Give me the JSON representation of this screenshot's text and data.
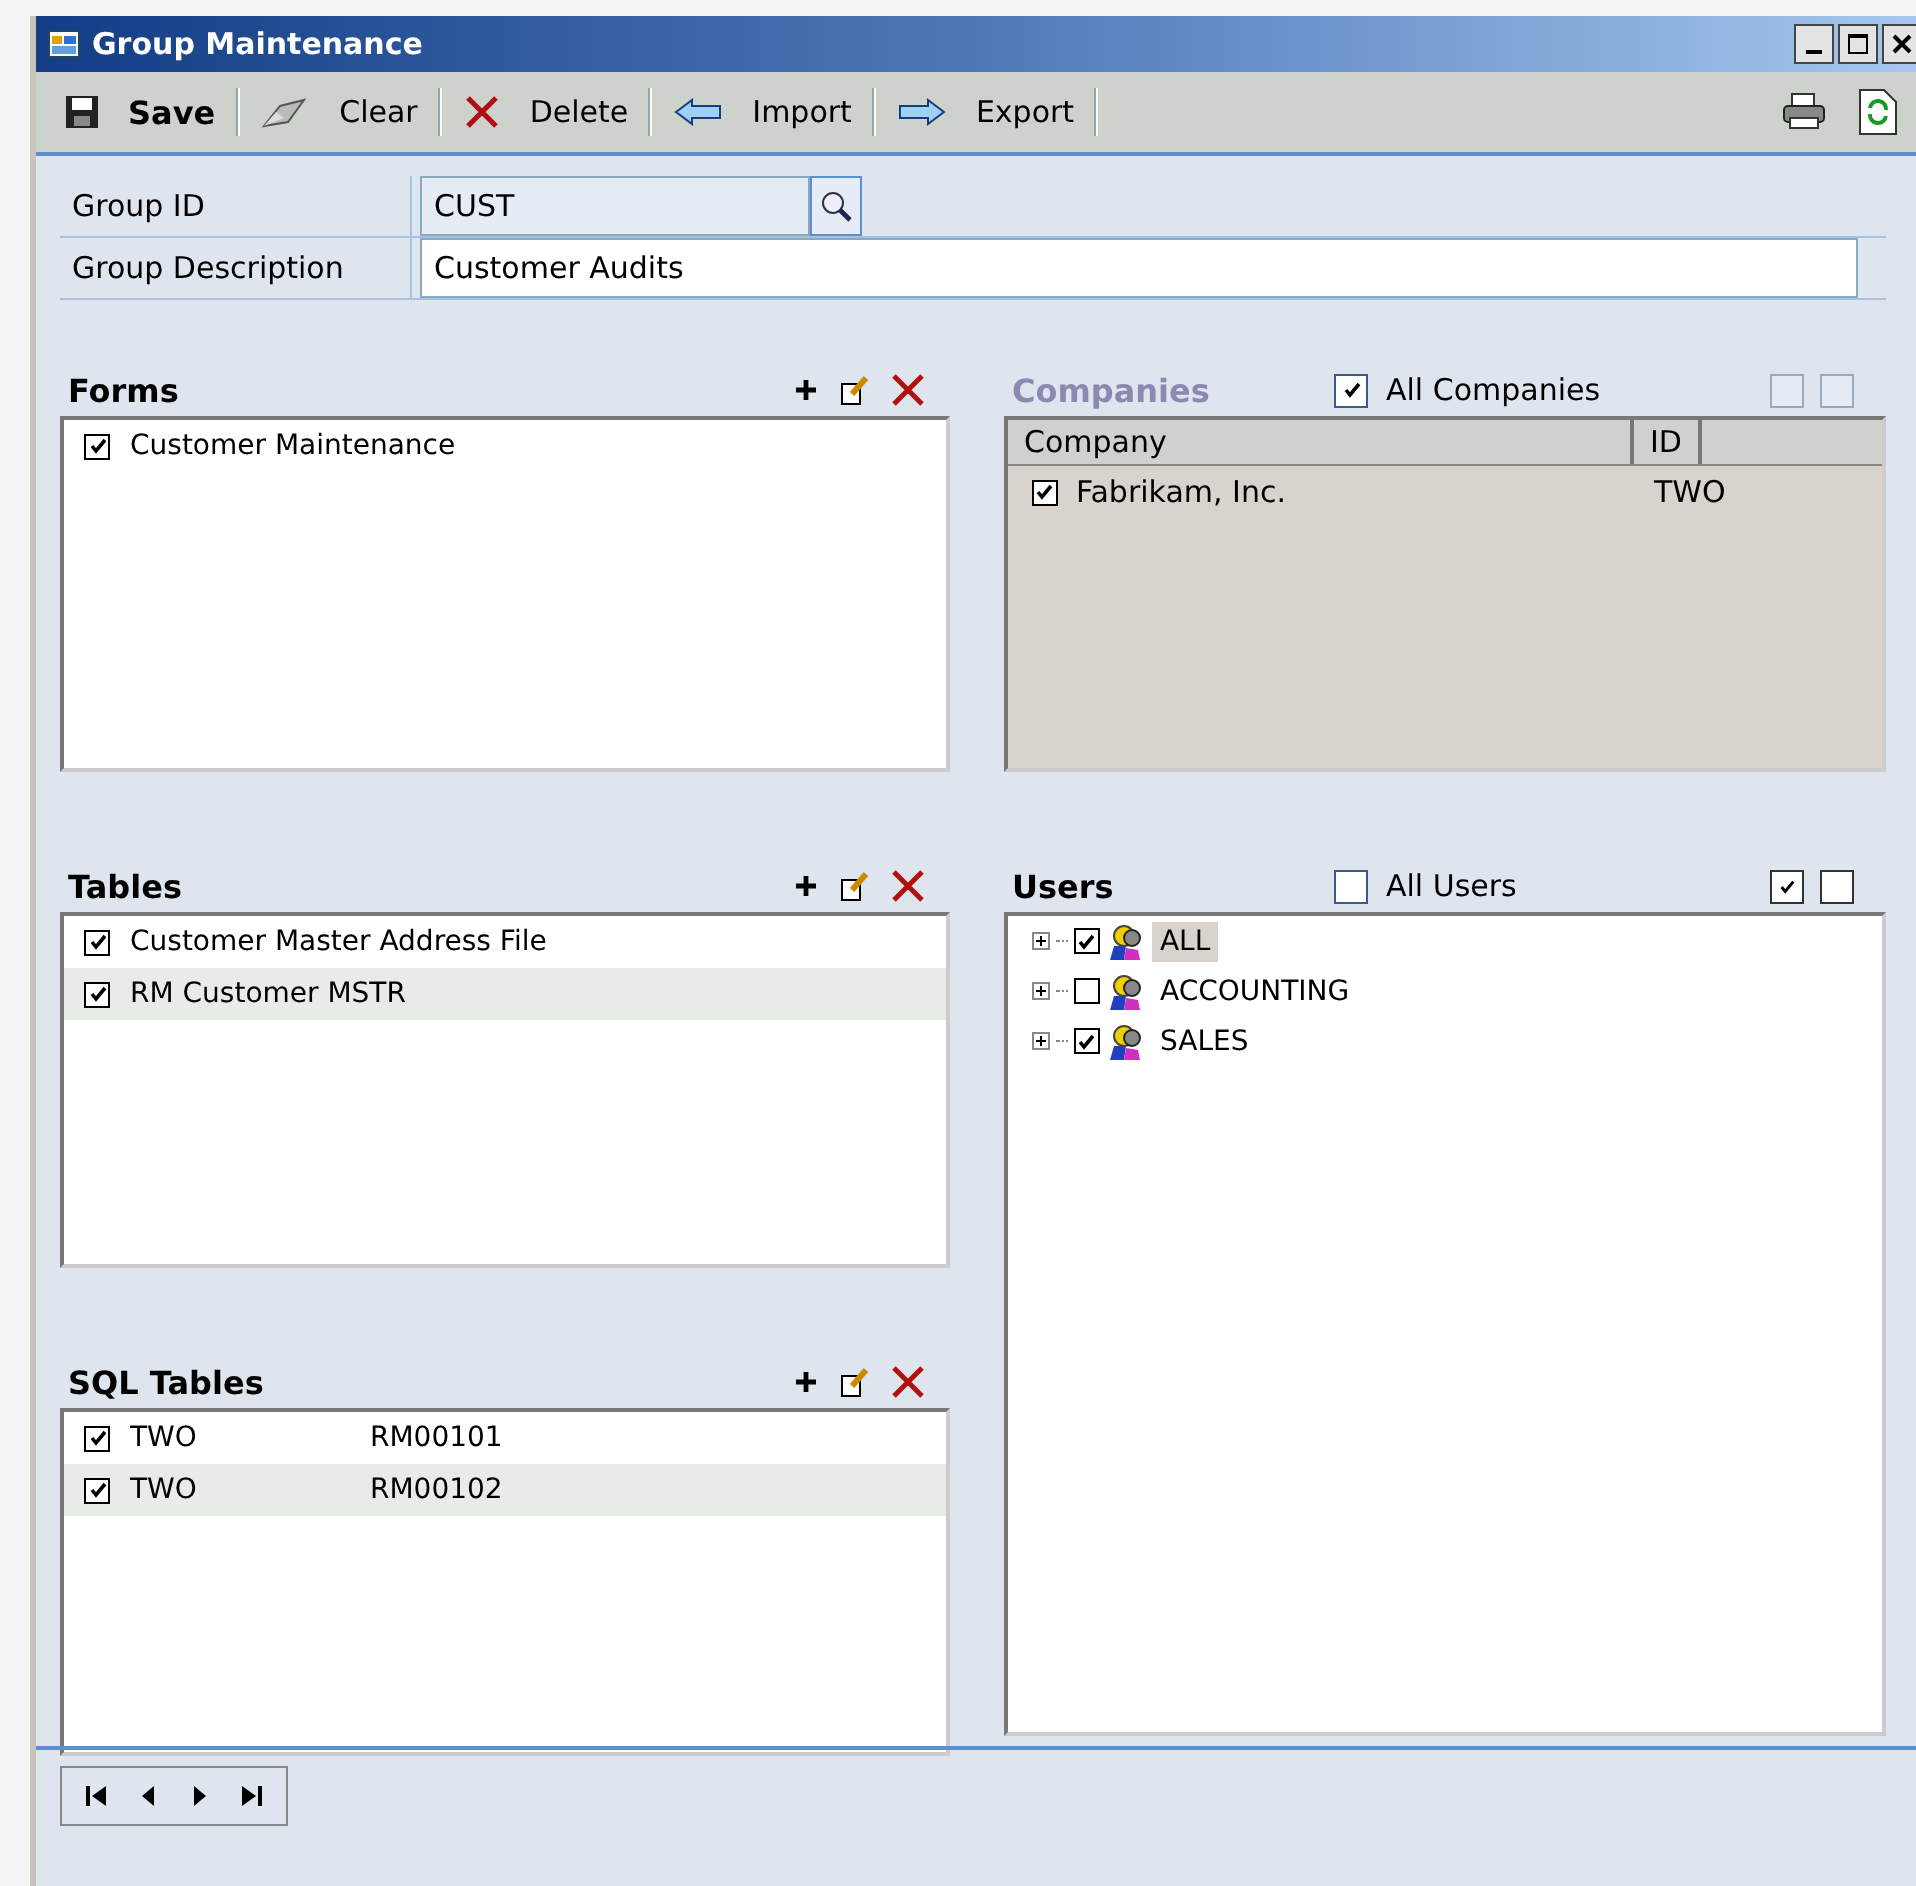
{
  "window": {
    "title": "Group Maintenance"
  },
  "toolbar": [
    {
      "kind": "save",
      "label": "Save"
    },
    {
      "kind": "clear",
      "label": "Clear"
    },
    {
      "kind": "delete",
      "label": "Delete"
    },
    {
      "kind": "import",
      "label": "Import"
    },
    {
      "kind": "export",
      "label": "Export"
    }
  ],
  "fields": [
    {
      "label": "Group ID",
      "value": "CUST",
      "kind": "lookup"
    },
    {
      "label": "Group Description",
      "value": "Customer Audits",
      "kind": "text"
    }
  ],
  "forms": {
    "title": "Forms",
    "rows": [
      {
        "checked": true,
        "cells": [
          "Customer Maintenance"
        ]
      }
    ]
  },
  "tables": {
    "title": "Tables",
    "rows": [
      {
        "checked": true,
        "cells": [
          "Customer Master Address File"
        ]
      },
      {
        "checked": true,
        "cells": [
          "RM Customer MSTR"
        ]
      }
    ]
  },
  "sql_tables": {
    "title": "SQL Tables",
    "rows": [
      {
        "checked": true,
        "cells": [
          "TWO",
          "RM00101"
        ]
      },
      {
        "checked": true,
        "cells": [
          "TWO",
          "RM00102"
        ]
      }
    ]
  },
  "companies": {
    "title": "Companies",
    "disabled": true,
    "all": {
      "label": "All Companies",
      "checked": true
    },
    "header_boxes": [
      {
        "checked": false
      },
      {
        "checked": false
      }
    ],
    "columns": [
      "Company",
      "ID"
    ],
    "rows": [
      {
        "checked": true,
        "cells": [
          "Fabrikam, Inc.",
          "TWO"
        ]
      }
    ]
  },
  "users": {
    "title": "Users",
    "all": {
      "label": "All Users",
      "checked": false
    },
    "header_boxes": [
      {
        "checked": true
      },
      {
        "checked": false
      }
    ],
    "items": [
      {
        "label": "ALL",
        "checked": true,
        "selected": true,
        "expanded": false
      },
      {
        "label": "ACCOUNTING",
        "checked": false,
        "selected": false,
        "expanded": false
      },
      {
        "label": "SALES",
        "checked": true,
        "selected": false,
        "expanded": false
      }
    ]
  }
}
